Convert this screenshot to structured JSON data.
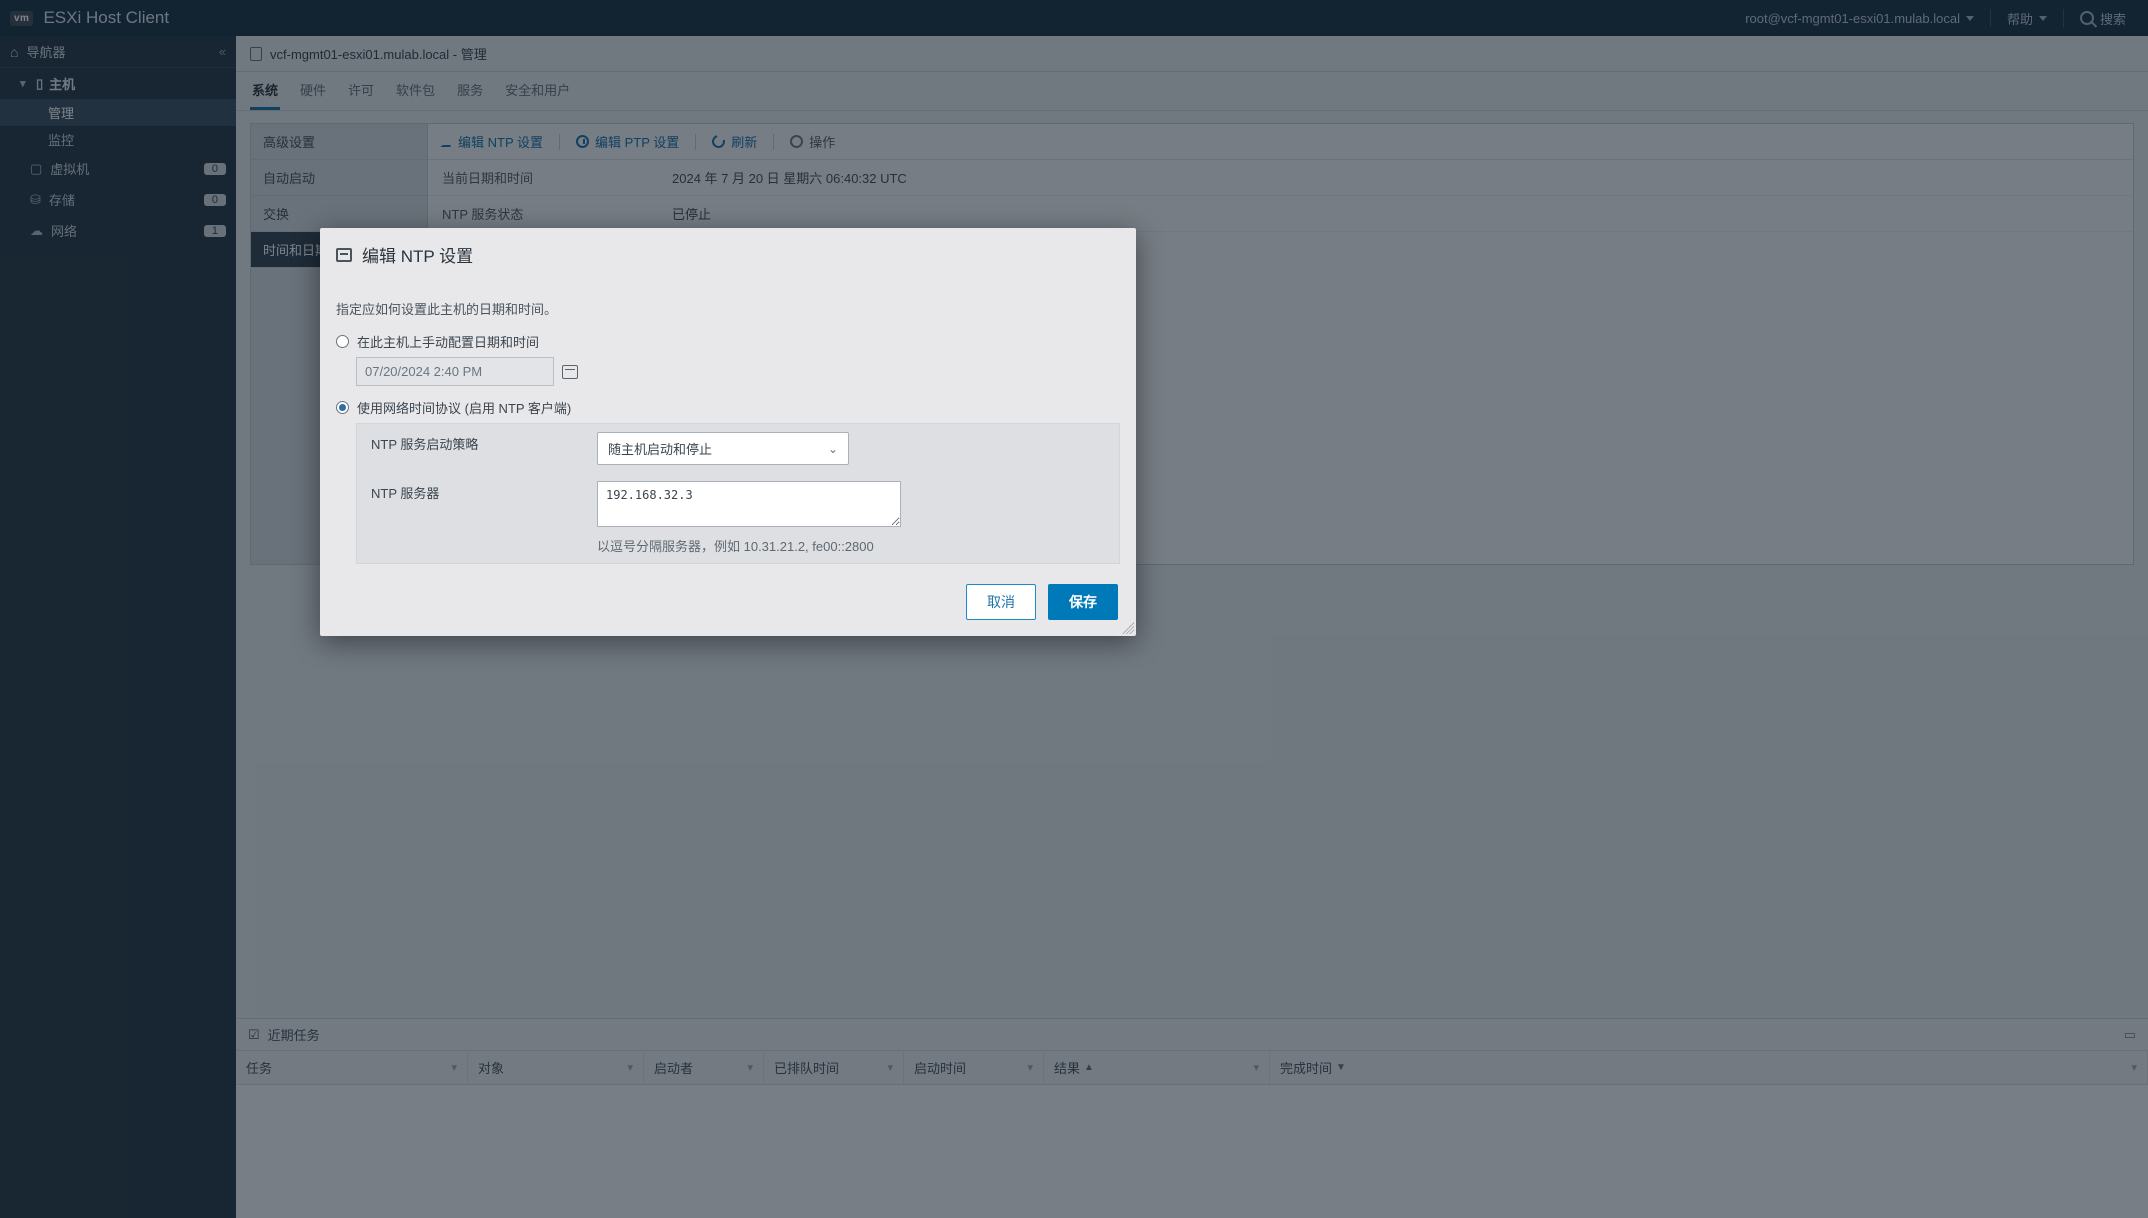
{
  "topbar": {
    "logo": "vm",
    "title": "ESXi Host Client",
    "user": "root@vcf-mgmt01-esxi01.mulab.local",
    "help": "帮助",
    "search_placeholder": "搜索"
  },
  "sidebar": {
    "header": "导航器",
    "host_label": "主机",
    "host_children": [
      "管理",
      "监控"
    ],
    "active_child_index": 0,
    "items": [
      {
        "label": "虚拟机",
        "count": "0"
      },
      {
        "label": "存储",
        "count": "0"
      },
      {
        "label": "网络",
        "count": "1"
      }
    ]
  },
  "breadcrumb": "vcf-mgmt01-esxi01.mulab.local - 管理",
  "tabs": [
    "系统",
    "硬件",
    "许可",
    "软件包",
    "服务",
    "安全和用户"
  ],
  "active_tab_index": 0,
  "left_panel": {
    "items": [
      "高级设置",
      "自动启动",
      "交换",
      "时间和日期"
    ],
    "active_index": 3
  },
  "toolbar": {
    "edit_ntp": "编辑 NTP 设置",
    "edit_ptp": "编辑 PTP 设置",
    "refresh": "刷新",
    "actions": "操作"
  },
  "detail_rows": [
    {
      "k": "当前日期和时间",
      "v": "2024 年 7 月 20 日 星期六 06:40:32 UTC"
    },
    {
      "k": "NTP 服务状态",
      "v": "已停止"
    }
  ],
  "tasks": {
    "title": "近期任务",
    "columns": {
      "task": "任务",
      "object": "对象",
      "initiator": "启动者",
      "queued": "已排队时间",
      "started": "启动时间",
      "result": "结果",
      "completed": "完成时间"
    }
  },
  "modal": {
    "title": "编辑 NTP 设置",
    "description": "指定应如何设置此主机的日期和时间。",
    "opt_manual": "在此主机上手动配置日期和时间",
    "manual_value": "07/20/2024 2:40 PM",
    "opt_ntp": "使用网络时间协议 (启用 NTP 客户端)",
    "selected": "ntp",
    "policy_label": "NTP 服务启动策略",
    "policy_value": "随主机启动和停止",
    "servers_label": "NTP 服务器",
    "servers_value": "192.168.32.3",
    "servers_hint": "以逗号分隔服务器，例如 10.31.21.2, fe00::2800",
    "cancel": "取消",
    "save": "保存"
  }
}
